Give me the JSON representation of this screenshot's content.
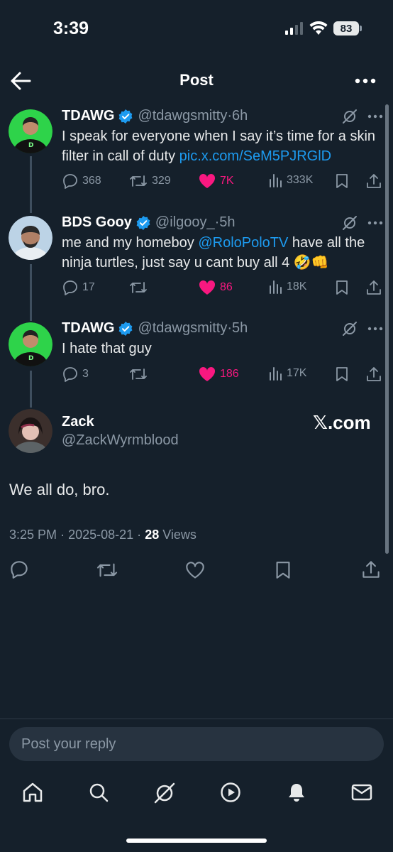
{
  "status_bar": {
    "time": "3:39",
    "battery": "83"
  },
  "header": {
    "title": "Post"
  },
  "thread": [
    {
      "name": "TDAWG",
      "handle": "@tdawgsmitty",
      "sep": "·",
      "time": "6h",
      "text": "I speak for everyone when I say it’s time for a skin filter in call of duty ",
      "link": "pic.x.com/SeM5PJRGlD",
      "replies": "368",
      "reposts": "329",
      "likes": "7K",
      "views": "333K"
    },
    {
      "name": "BDS Gooy",
      "handle": "@ilgooy_",
      "sep": "·",
      "time": "5h",
      "text_before": "me and my homeboy ",
      "mention": "@RoloPoloTV",
      "text_after": " have all the ninja turtles, just say u cant buy all 4 🤣👊",
      "replies": "17",
      "likes": "86",
      "views": "18K"
    },
    {
      "name": "TDAWG",
      "handle": "@tdawgsmitty",
      "sep": "·",
      "time": "5h",
      "text": "I hate that guy",
      "replies": "3",
      "likes": "186",
      "views": "17K"
    }
  ],
  "main_post": {
    "name": "Zack",
    "handle": "@ZackWyrmblood",
    "watermark": "𝕏.com",
    "text": "We all do, bro.",
    "time": "3:25 PM",
    "date": "2025-08-21",
    "sep": "·",
    "views_count": "28",
    "views_label": "Views"
  },
  "reply": {
    "placeholder": "Post your reply"
  },
  "colors": {
    "background": "#15202b",
    "link": "#1d9bf0",
    "like": "#f91880",
    "verified": "#1d9bf0",
    "muted": "#8b98a5"
  },
  "icons": [
    "back-arrow-icon",
    "more-icon",
    "verified-icon",
    "grok-icon",
    "reply-icon",
    "repost-icon",
    "heart-icon",
    "views-icon",
    "bookmark-icon",
    "share-icon",
    "home-icon",
    "search-icon",
    "grok-nav-icon",
    "video-icon",
    "bell-icon",
    "mail-icon"
  ]
}
